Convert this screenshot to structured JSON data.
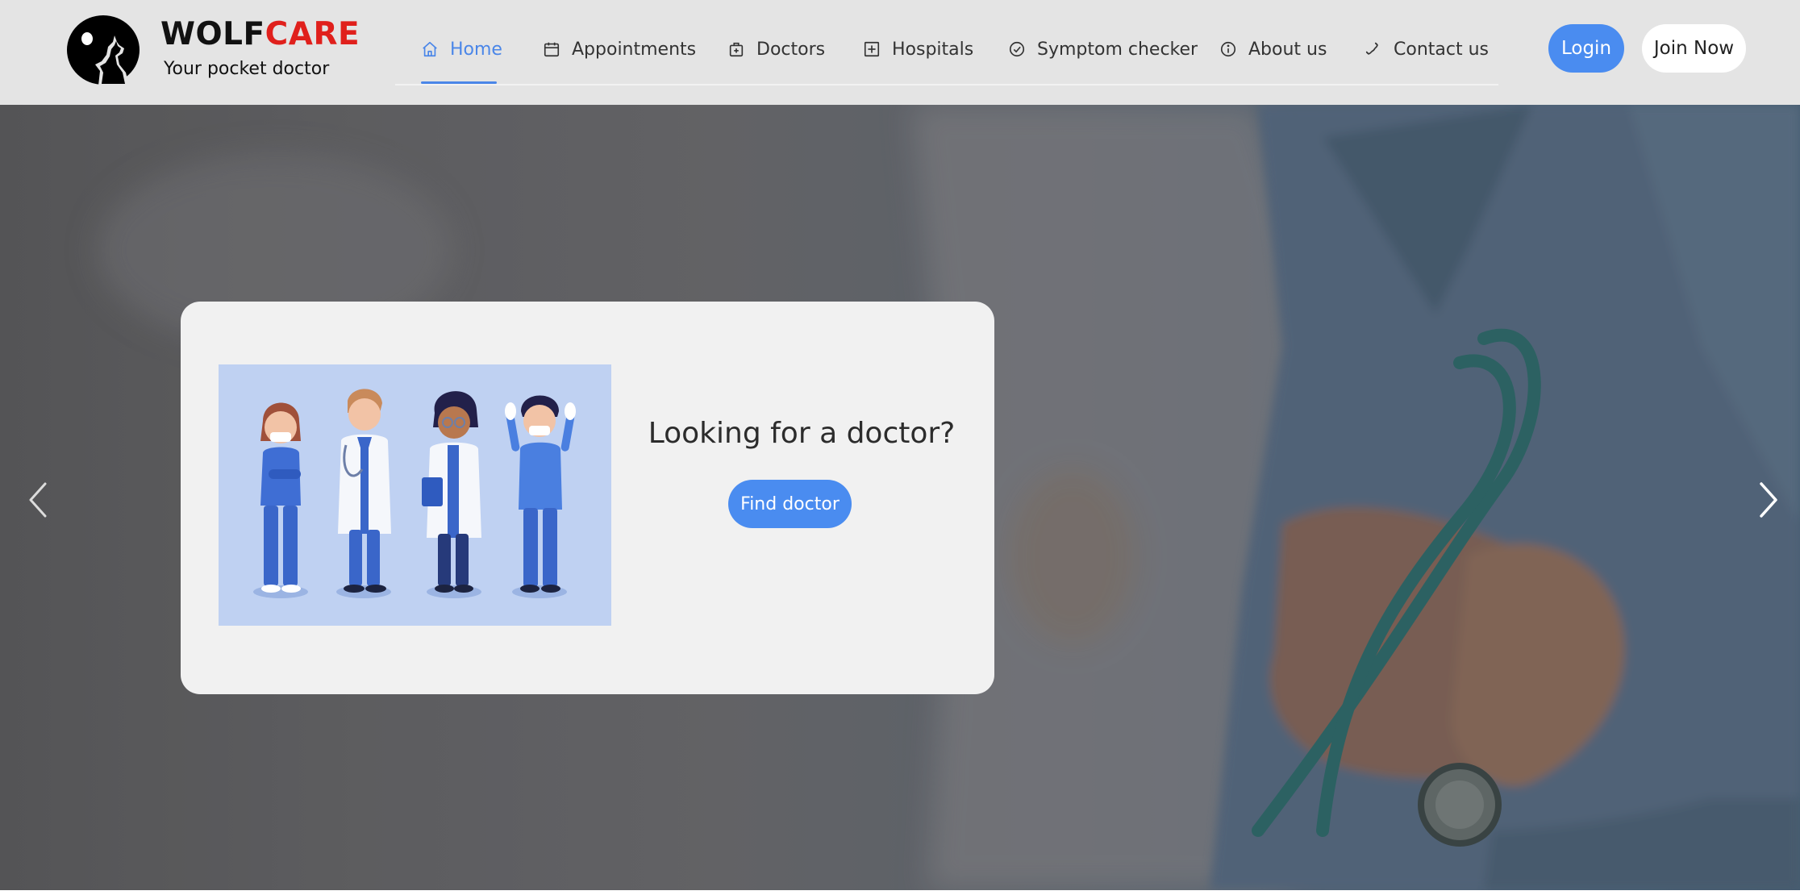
{
  "brand": {
    "name_part1": "WOLF",
    "name_part2": "CARE",
    "tagline": "Your pocket doctor",
    "logo_icon": "wolf-howling-moon-icon",
    "accent_color": "#e0201c"
  },
  "nav": {
    "active_color": "#4a86e8",
    "items": [
      {
        "label": "Home",
        "icon": "home-icon"
      },
      {
        "label": "Appointments",
        "icon": "calendar-icon"
      },
      {
        "label": "Doctors",
        "icon": "medical-bag-icon"
      },
      {
        "label": "Hospitals",
        "icon": "hospital-plus-icon"
      },
      {
        "label": "Symptom checker",
        "icon": "check-circle-icon"
      },
      {
        "label": "About us",
        "icon": "info-circle-icon"
      },
      {
        "label": "Contact us",
        "icon": "phone-icon"
      }
    ],
    "active_item": "Home"
  },
  "auth": {
    "login_label": "Login",
    "join_label": "Join Now",
    "primary_color": "#4a8cf0"
  },
  "hero": {
    "card_title": "Looking for a doctor?",
    "cta_label": "Find doctor",
    "prev_icon": "chevron-left-icon",
    "next_icon": "chevron-right-icon"
  }
}
